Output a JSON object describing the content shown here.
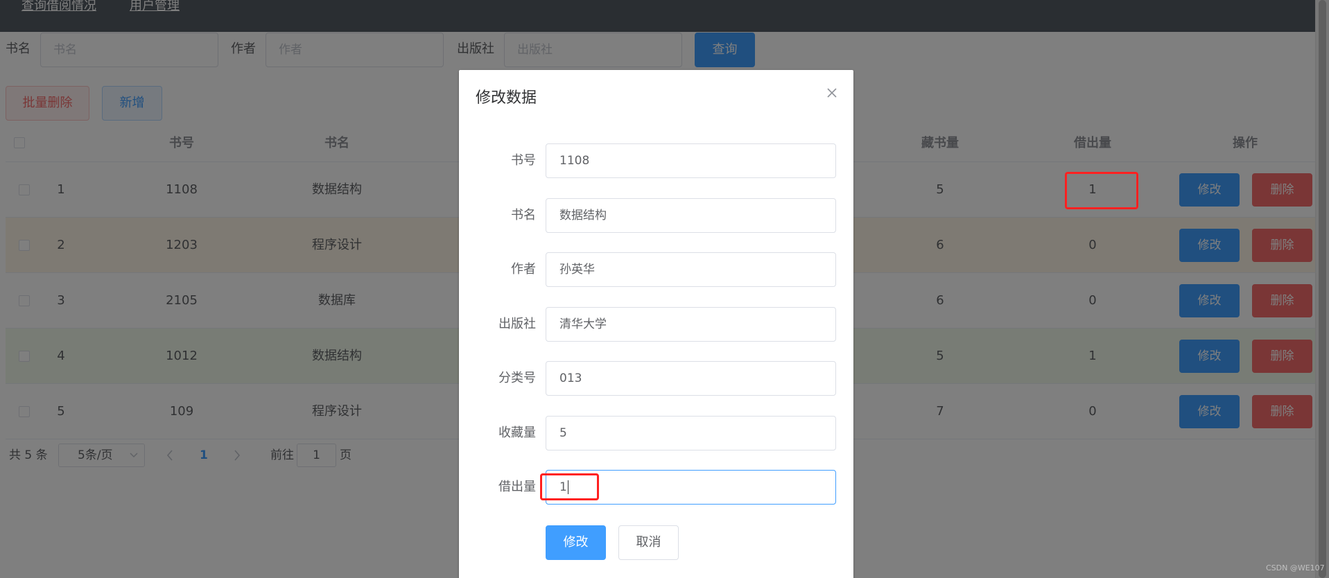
{
  "nav": {
    "items": [
      "查询借阅情况",
      "用户管理"
    ]
  },
  "search": {
    "title_label": "书名",
    "title_placeholder": "书名",
    "author_label": "作者",
    "author_placeholder": "作者",
    "publisher_label": "出版社",
    "publisher_placeholder": "出版社",
    "search_button": "查询"
  },
  "toolbar": {
    "batch_delete": "批量删除",
    "add": "新增"
  },
  "table": {
    "headers": {
      "book_no": "书号",
      "title": "书名",
      "stock": "藏书量",
      "lent": "借出量",
      "actions": "操作"
    },
    "rows": [
      {
        "index": "1",
        "book_no": "1108",
        "title": "数据结构",
        "stock": "5",
        "lent": "1",
        "edit": "修改",
        "delete": "删除"
      },
      {
        "index": "2",
        "book_no": "1203",
        "title": "程序设计",
        "stock": "6",
        "lent": "0",
        "edit": "修改",
        "delete": "删除"
      },
      {
        "index": "3",
        "book_no": "2105",
        "title": "数据库",
        "stock": "6",
        "lent": "0",
        "edit": "修改",
        "delete": "删除"
      },
      {
        "index": "4",
        "book_no": "1012",
        "title": "数据结构",
        "stock": "5",
        "lent": "1",
        "edit": "修改",
        "delete": "删除"
      },
      {
        "index": "5",
        "book_no": "109",
        "title": "程序设计",
        "stock": "7",
        "lent": "0",
        "edit": "修改",
        "delete": "删除"
      }
    ]
  },
  "pagination": {
    "total": "共 5 条",
    "page_size": "5条/页",
    "current_page": "1",
    "goto_label": "前往",
    "goto_value": "1",
    "page_suffix": "页"
  },
  "dialog": {
    "title": "修改数据",
    "fields": {
      "book_no": {
        "label": "书号",
        "value": "1108"
      },
      "title": {
        "label": "书名",
        "value": "数据结构"
      },
      "author": {
        "label": "作者",
        "value": "孙英华"
      },
      "publisher": {
        "label": "出版社",
        "value": "清华大学"
      },
      "category": {
        "label": "分类号",
        "value": "013"
      },
      "stock": {
        "label": "收藏量",
        "value": "5"
      },
      "lent": {
        "label": "借出量",
        "value": "1"
      }
    },
    "submit": "修改",
    "cancel": "取消"
  },
  "watermark": "CSDN @WE107",
  "colors": {
    "nav_bg": "#545c64",
    "primary": "#409eff",
    "danger": "#f56c6c",
    "annotation": "#ff2020"
  }
}
